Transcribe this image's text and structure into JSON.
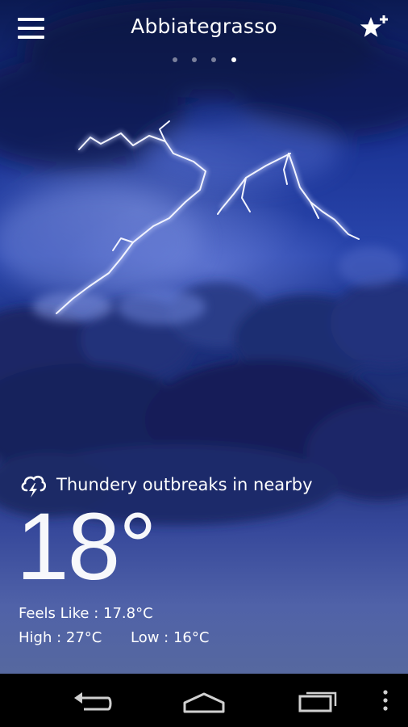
{
  "header": {
    "title": "Abbiategrasso",
    "menu_icon": "hamburger-menu-icon",
    "favorite_icon": "star-add-icon"
  },
  "pager": {
    "count": 4,
    "active_index": 3
  },
  "weather": {
    "condition": "Thundery outbreaks in nearby",
    "condition_icon": "thunderstorm-cloud-icon",
    "temperature": "18°",
    "feels_like": "Feels Like : 17.8°C",
    "high": "High : 27°C",
    "low": "Low : 16°C"
  },
  "nav": {
    "back_icon": "back-icon",
    "home_icon": "home-icon",
    "recents_icon": "recent-apps-icon",
    "overflow_icon": "overflow-menu-icon"
  },
  "colors": {
    "sky_top": "#0b1a52",
    "sky_mid": "#2a46ad",
    "sky_bottom": "#56689f",
    "navbar": "#000000"
  }
}
